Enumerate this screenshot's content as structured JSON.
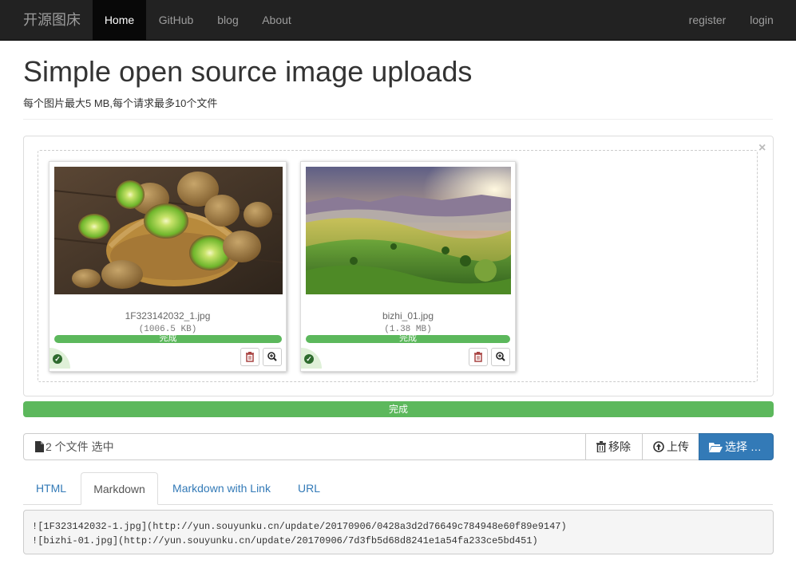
{
  "navbar": {
    "brand": "开源图床",
    "items": [
      {
        "label": "Home",
        "active": true
      },
      {
        "label": "GitHub"
      },
      {
        "label": "blog"
      },
      {
        "label": "About"
      }
    ],
    "right_items": [
      {
        "label": "register"
      },
      {
        "label": "login"
      }
    ]
  },
  "header": {
    "title": "Simple open source image uploads",
    "subtitle": "每个图片最大5 MB,每个请求最多10个文件"
  },
  "preview": {
    "close_glyph": "×",
    "files": [
      {
        "name": "1F323142032_1.jpg",
        "size": "(1006.5 KB)",
        "progress": 100,
        "progress_text": "完成",
        "status_icon": "check-circle-icon",
        "delete_icon": "trash-icon",
        "zoom_icon": "zoom-in-icon"
      },
      {
        "name": "bizhi_01.jpg",
        "size": "(1.38 MB)",
        "progress": 100,
        "progress_text": "完成",
        "status_icon": "check-circle-icon",
        "delete_icon": "trash-icon",
        "zoom_icon": "zoom-in-icon"
      }
    ]
  },
  "total_progress": {
    "percent": 100,
    "text": "完成"
  },
  "file_input": {
    "caption_icon": "file-icon",
    "caption": "2 个文件 选中",
    "remove_label": "移除",
    "upload_label": "上传",
    "browse_label": "选择 …"
  },
  "tabs": [
    {
      "label": "HTML"
    },
    {
      "label": "Markdown",
      "active": true
    },
    {
      "label": "Markdown with Link"
    },
    {
      "label": "URL"
    }
  ],
  "output": {
    "lines": [
      "![1F323142032-1.jpg](http://yun.souyunku.cn/update/20170906/0428a3d2d76649c784948e60f89e9147)",
      "![bizhi-01.jpg](http://yun.souyunku.cn/update/20170906/7d3fb5d68d8241e1a54fa233ce5bd451)"
    ]
  },
  "colors": {
    "navbar_bg": "#222222",
    "success": "#5cb85c",
    "primary": "#337ab7",
    "danger": "#a94442"
  }
}
